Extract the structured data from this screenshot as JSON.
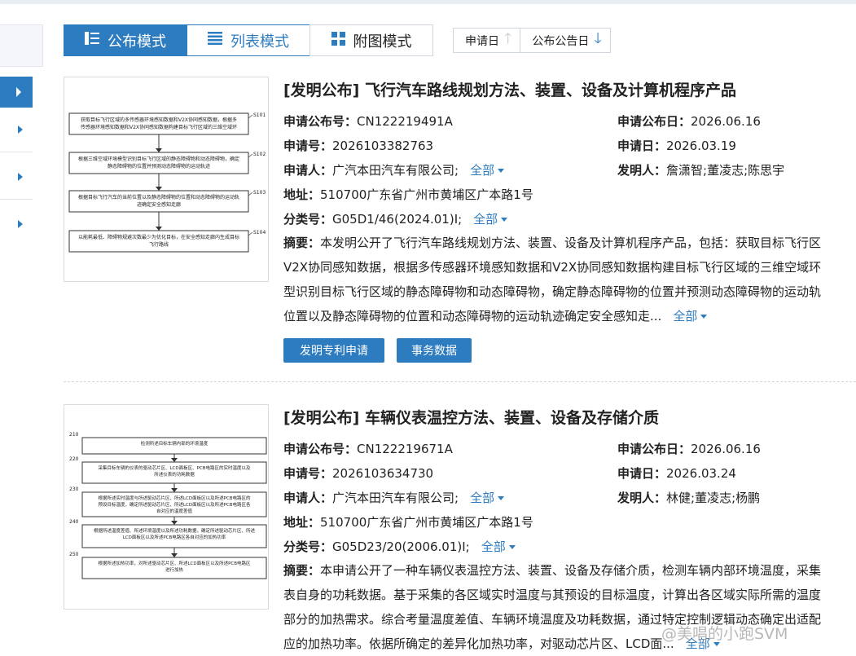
{
  "view_tabs": [
    {
      "label": "公布模式",
      "active": true
    },
    {
      "label": "列表模式",
      "active": false
    },
    {
      "label": "附图模式",
      "active": false
    }
  ],
  "sort": {
    "apply_date": "申请日",
    "publish_date": "公布公告日"
  },
  "colors": {
    "accent": "#2e7cc0"
  },
  "results": [
    {
      "title": "[发明公布] 飞行汽车路线规划方法、装置、设备及计算机程序产品",
      "pub_no_label": "申请公布号：",
      "pub_no": "CN122219491A",
      "pub_date_label": "申请公布日：",
      "pub_date": "2026.06.16",
      "app_no_label": "申请号：",
      "app_no": "2026103382763",
      "app_date_label": "申请日：",
      "app_date": "2026.03.19",
      "applicant_label": "申请人：",
      "applicant": "广汽本田汽车有限公司;",
      "inventor_label": "发明人：",
      "inventor": "詹潇智;董凌志;陈思宇",
      "address_label": "地址：",
      "address": "510700广东省广州市黄埔区广本路1号",
      "class_label": "分类号：",
      "class": "G05D1/46(2024.01)I;",
      "all_label": "全部",
      "abstract_label": "摘要：",
      "abstract_lines": [
        "本发明公开了飞行汽车路线规划方法、装置、设备及计算机程序产品，包括：获取目标飞行区",
        "V2X协同感知数据，根据多传感器环境感知数据和V2X协同感知数据构建目标飞行区域的三维空域环",
        "型识别目标飞行区域的静态障碍物和动态障碍物，确定静态障碍物的位置并预测动态障碍物的运动轨",
        "位置以及静态障碍物的位置和动态障碍物的运动轨迹确定安全感知走..."
      ],
      "buttons": [
        "发明专利申请",
        "事务数据"
      ],
      "figure_steps": [
        {
          "text": "获取目标飞行区域的多传感器环境感知数据和V2X协同感知数据，根据多传感器环境感知数据和V2X协同感知数据构建目标飞行区域的三维空域环境模型",
          "id": "S101"
        },
        {
          "text": "根据三维空域环境模型识别目标飞行区域的静态障碍物和动态障碍物，确定静态障碍物的位置并预测动态障碍物的运动轨迹",
          "id": "S102"
        },
        {
          "text": "根据目标飞行汽车的当前位置以及静态障碍物的位置和动态障碍物的运动轨迹确定安全感知走廊",
          "id": "S103"
        },
        {
          "text": "以能耗最低、障碍物规避次数最少为优化目标，在安全感知走廊内生成目标飞行路线",
          "id": "S104"
        }
      ]
    },
    {
      "title": "[发明公布] 车辆仪表温控方法、装置、设备及存储介质",
      "pub_no_label": "申请公布号：",
      "pub_no": "CN122219671A",
      "pub_date_label": "申请公布日：",
      "pub_date": "2026.06.16",
      "app_no_label": "申请号：",
      "app_no": "2026103634730",
      "app_date_label": "申请日：",
      "app_date": "2026.03.24",
      "applicant_label": "申请人：",
      "applicant": "广汽本田汽车有限公司;",
      "inventor_label": "发明人：",
      "inventor": "林健;董凌志;杨鹏",
      "address_label": "地址：",
      "address": "510700广东省广州市黄埔区广本路1号",
      "class_label": "分类号：",
      "class": "G05D23/20(2006.01)I;",
      "all_label": "全部",
      "abstract_label": "摘要：",
      "abstract_lines": [
        "本申请公开了一种车辆仪表温控方法、装置、设备及存储介质，检测车辆内部环境温度，采集",
        "表自身的功耗数据。基于采集的各区域实时温度与其预设的目标温度，计算出各区域实际所需的温度",
        "部分的加热需求。综合考量温度差值、车辆环境温度及功耗数据，通过特定控制逻辑动态确定出适配",
        "应的加热功率。依据所确定的差异化加热功率，对驱动芯片区、LCD面..."
      ],
      "figure_steps": [
        {
          "id": "210",
          "text": "检测所述目标车辆内部的环境温度"
        },
        {
          "id": "220",
          "text": "采集目标车辆的仪表的驱动芯片区、LCD面板区、PCB电路区的实时温度以及所述仪表的功耗数据"
        },
        {
          "id": "230",
          "text": "根据所述实时温度与所述驱动芯片区、所述LCD面板区以及所述PCB电路区的预设目标温度，确定所述驱动芯片区、所述LCD面板区以及所述PCB电路区各自对应的温度差值"
        },
        {
          "id": "240",
          "text": "根据所述温度差值、所述环境温度以及所述功耗数据，确定所述驱动芯片区、所述LCD面板区以及所述PCB电路区各自对应的加热功率"
        },
        {
          "id": "250",
          "text": "根据所述加热功率，对所述驱动芯片区、所述LCD面板区以及所述PCB电路区进行加热"
        }
      ]
    }
  ],
  "watermark": "@美唱的小跑SVM"
}
